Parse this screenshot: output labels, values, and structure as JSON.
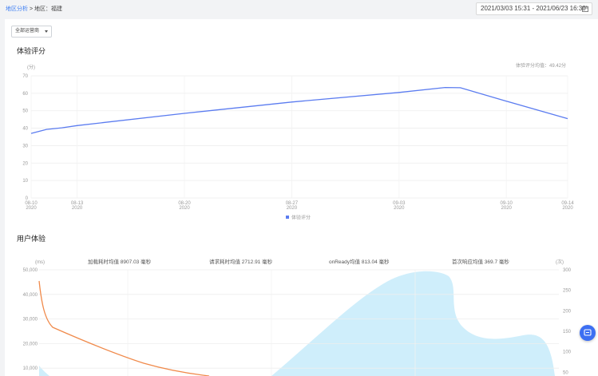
{
  "breadcrumb": {
    "root": "地区分析",
    "separator": ">",
    "current": "地区：福建"
  },
  "date_range": {
    "value": "2021/03/03 15:31 - 2021/06/23 16:30",
    "icon": "calendar-icon"
  },
  "filter": {
    "selected": "全部运营商"
  },
  "score_section": {
    "title": "体验评分",
    "average_label": "体验评分均值：49.42分",
    "legend": "体验评分",
    "ylabel": "(分)"
  },
  "experience_section": {
    "title": "用户体验",
    "stats": {
      "load": "加载耗时均值 8907.03 毫秒",
      "request": "请求耗时均值 2712.91 毫秒",
      "onready": "onReady均值 813.04 毫秒",
      "first_response": "首次响应均值 369.7 毫秒"
    },
    "left_unit": "(ms)",
    "right_unit": "(次)"
  },
  "fab": {
    "icon": "chat-icon"
  },
  "colors": {
    "score_line": "#5b7cf0",
    "load_line": "#f08a4b",
    "area_fill": "#cfeefb",
    "link": "#3a7cf4"
  },
  "chart_data": [
    {
      "type": "line",
      "title": "体验评分",
      "ylabel": "(分)",
      "ylim": [
        0,
        70
      ],
      "yticks": [
        "0",
        "10",
        "20",
        "30",
        "40",
        "50",
        "60",
        "70"
      ],
      "xticks": [
        {
          "day": "08-10",
          "year": "2020"
        },
        {
          "day": "08-13",
          "year": "2020"
        },
        {
          "day": "08-20",
          "year": "2020"
        },
        {
          "day": "08-27",
          "year": "2020"
        },
        {
          "day": "09-03",
          "year": "2020"
        },
        {
          "day": "09-10",
          "year": "2020"
        },
        {
          "day": "09-14",
          "year": "2020"
        }
      ],
      "series": [
        {
          "name": "体验评分",
          "points": [
            [
              "2020-08-10",
              37
            ],
            [
              "2020-08-11",
              39.3
            ],
            [
              "2020-08-12",
              40.2
            ],
            [
              "2020-08-13",
              41.5
            ],
            [
              "2020-08-20",
              48.5
            ],
            [
              "2020-08-27",
              55
            ],
            [
              "2020-09-03",
              60.5
            ],
            [
              "2020-09-06",
              63.3
            ],
            [
              "2020-09-07",
              63.2
            ],
            [
              "2020-09-10",
              55.5
            ],
            [
              "2020-09-14",
              45.5
            ]
          ]
        }
      ],
      "grid": true,
      "legend_position": "bottom"
    },
    {
      "type": "area",
      "title": "用户体验",
      "left_axis": {
        "unit": "(ms)",
        "ylim": [
          0,
          50000
        ],
        "ticks": [
          "10,000",
          "20,000",
          "30,000",
          "40,000",
          "50,000"
        ]
      },
      "right_axis": {
        "unit": "(次)",
        "ylim": [
          0,
          300
        ],
        "ticks": [
          "50",
          "100",
          "150",
          "200",
          "250",
          "300"
        ]
      }
    }
  ]
}
